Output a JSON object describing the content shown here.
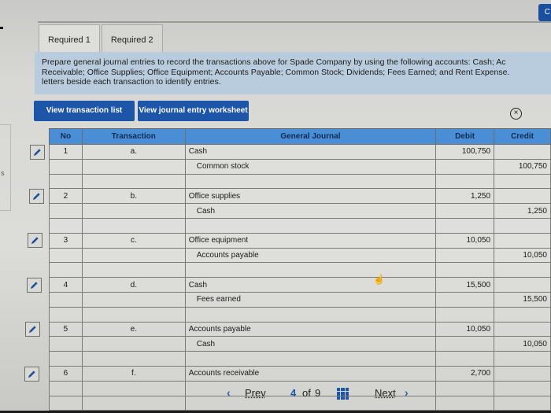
{
  "tabs": [
    {
      "label": "Required 1",
      "active": true
    },
    {
      "label": "Required 2",
      "active": false
    }
  ],
  "corner_button_label": "C",
  "left_panel_fragment": "s",
  "instructions": {
    "line1": "Prepare general journal entries to record the transactions above for Spade Company by using the following accounts: Cash; Ac",
    "line2": "Receivable; Office Supplies; Office Equipment; Accounts Payable; Common Stock; Dividends; Fees Earned; and Rent Expense.",
    "line3": "letters beside each transaction to identify entries."
  },
  "buttons": {
    "transaction_list": "View transaction list",
    "journal_worksheet": "View journal entry worksheet",
    "close_icon": "close-circle-icon"
  },
  "table": {
    "headers": {
      "no": "No",
      "transaction": "Transaction",
      "general_journal": "General Journal",
      "debit": "Debit",
      "credit": "Credit"
    },
    "entries": [
      {
        "no": "1",
        "transaction": "a.",
        "debit_account": "Cash",
        "credit_account": "Common stock",
        "debit": "100,750",
        "credit": "100,750"
      },
      {
        "no": "2",
        "transaction": "b.",
        "debit_account": "Office supplies",
        "credit_account": "Cash",
        "debit": "1,250",
        "credit": "1,250"
      },
      {
        "no": "3",
        "transaction": "c.",
        "debit_account": "Office equipment",
        "credit_account": "Accounts payable",
        "debit": "10,050",
        "credit": "10,050"
      },
      {
        "no": "4",
        "transaction": "d.",
        "debit_account": "Cash",
        "credit_account": "Fees earned",
        "debit": "15,500",
        "credit": "15,500"
      },
      {
        "no": "5",
        "transaction": "e.",
        "debit_account": "Accounts payable",
        "credit_account": "Cash",
        "debit": "10,050",
        "credit": "10,050"
      },
      {
        "no": "6",
        "transaction": "f.",
        "debit_account": "Accounts receivable",
        "credit_account": "",
        "debit": "2,700",
        "credit": ""
      }
    ]
  },
  "pagination": {
    "prev_label": "Prev",
    "current": "4",
    "of_label": "of",
    "total": "9",
    "next_label": "Next"
  }
}
